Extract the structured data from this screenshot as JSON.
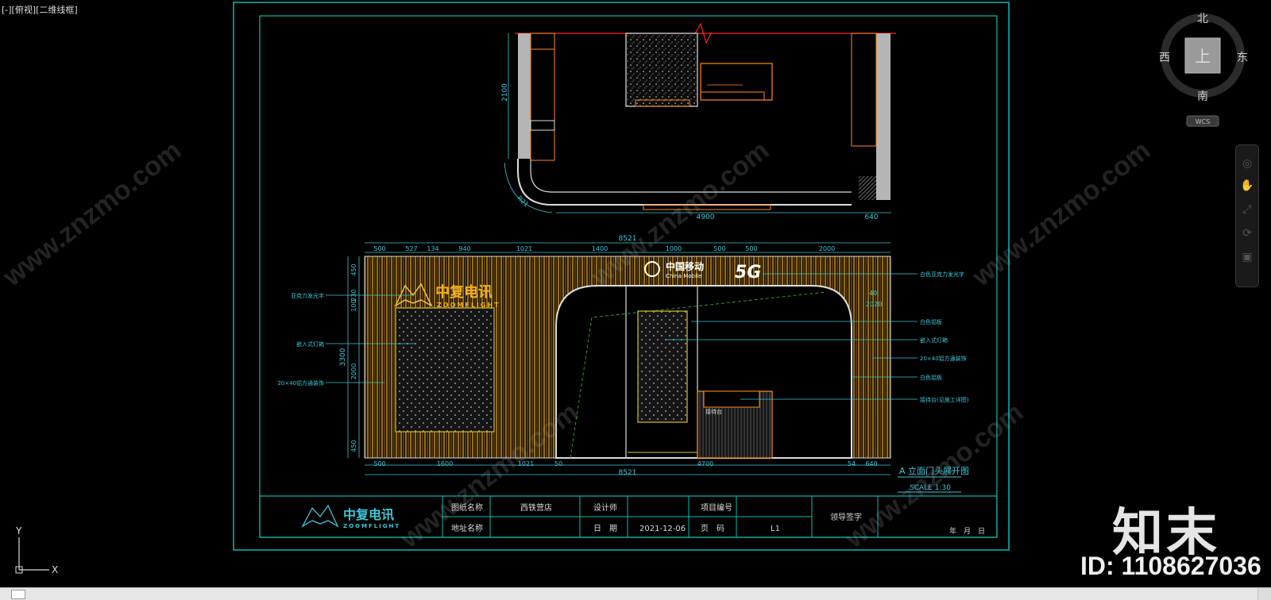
{
  "viewport_label": "[-][俯视][二维线框]",
  "compass": {
    "north": "北",
    "south": "南",
    "east": "东",
    "west": "西",
    "top": "上",
    "wcs": "WCS"
  },
  "ucs": {
    "y": "Y",
    "x": "X"
  },
  "plan": {
    "dim_vertical": "2100",
    "dim_bottom_main": "4900",
    "dim_bottom_right": "640",
    "dim_radius": "R21"
  },
  "elevation": {
    "top_dims": [
      "500",
      "527",
      "134",
      "940",
      "1021",
      "1400",
      "1000",
      "500",
      "500",
      "2000"
    ],
    "top_total": "8521",
    "bottom_dims": [
      "500",
      "1600",
      "1021",
      "50",
      "4700",
      "54",
      "640"
    ],
    "bottom_total": "8521",
    "left_dims": [
      "450",
      "230",
      "100",
      "2000",
      "450"
    ],
    "left_total": "3300",
    "right_small": [
      "40",
      "2020"
    ],
    "brand_cn": "中复电讯",
    "brand_en": "ZOOMFLIGHT",
    "mobile_cn": "中国移动",
    "mobile_en": "China Mobile",
    "badge_5g": "5G",
    "left_notes": [
      "亚克力发光字",
      "嵌入式灯箱",
      "20×40铝方通装饰"
    ],
    "right_notes": [
      "白色亚克力发光字",
      "白色铝板",
      "嵌入式灯箱",
      "20×40铝方通装饰",
      "白色铝板",
      "接待台(见施工详图)"
    ],
    "desk_label": "接待台",
    "title": "A 立面门头展开图",
    "scale": "SCALE 1:30"
  },
  "title_block": {
    "logo_cn": "中复电讯",
    "logo_en": "ZOOMFLIGHT",
    "drawing_name_label": "图纸名称",
    "drawing_name": "西铁营店",
    "designer_label": "设计师",
    "project_no_label": "项目编号",
    "address_label": "地址名称",
    "date_label": "日　期",
    "date": "2021-12-06",
    "page_label": "页　码",
    "page": "L1",
    "approval_label": "领导签字",
    "ymd": "年　月　日"
  },
  "watermark": {
    "logo": "知末",
    "id": "ID: 1108627036",
    "url": "www.znzmo.com"
  },
  "colors": {
    "frame": "#12b7b0",
    "cad_text": "#3fc7d9",
    "wood": "#b8860b",
    "orange": "#ff8c1a",
    "red": "#ff2020",
    "green": "#2e9a2e"
  }
}
